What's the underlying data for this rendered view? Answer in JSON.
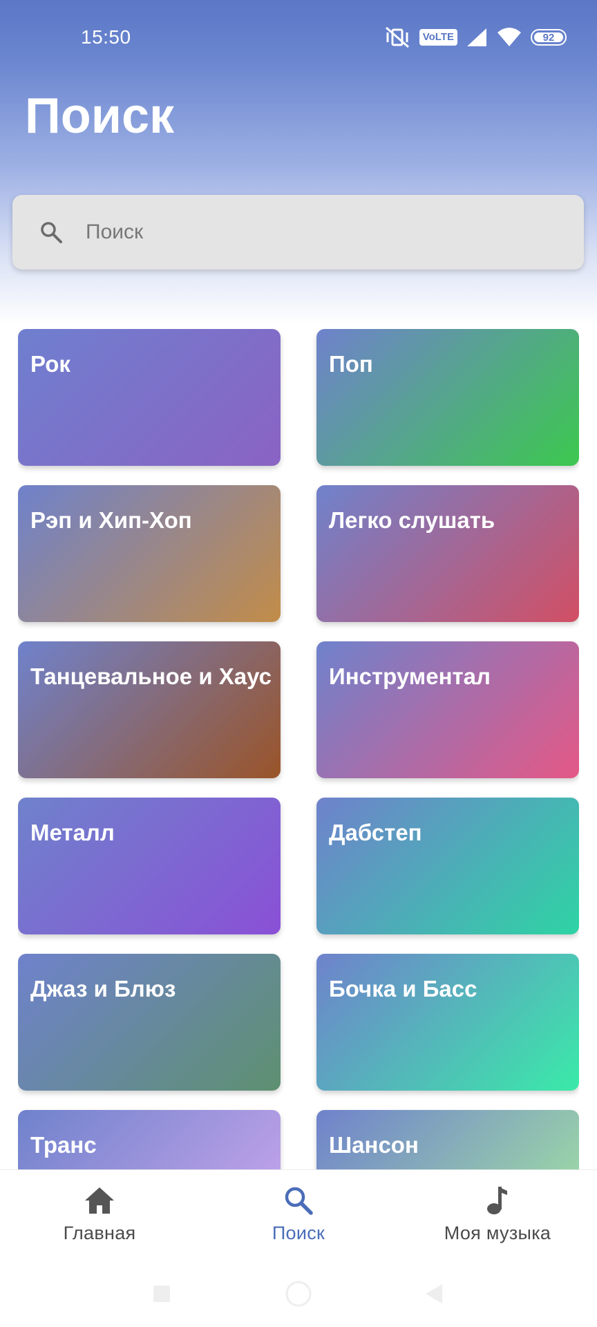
{
  "status_bar": {
    "time": "15:50",
    "network_badge": "VoLTE",
    "battery": "92",
    "icons": [
      "vibrate-off-icon",
      "volte-icon",
      "signal-icon",
      "wifi-icon",
      "battery-icon"
    ]
  },
  "header": {
    "title": "Поиск"
  },
  "search": {
    "placeholder": "Поиск",
    "value": "",
    "icon": "search-icon"
  },
  "genres": [
    {
      "label": "Рок",
      "colors": [
        "#6f7fcf",
        "#8a63c4"
      ]
    },
    {
      "label": "Поп",
      "colors": [
        "#6f82cc",
        "#3cc84e"
      ]
    },
    {
      "label": "Рэп и Хип-Хоп",
      "colors": [
        "#6f82cc",
        "#c28c48"
      ]
    },
    {
      "label": "Легко слушать",
      "colors": [
        "#6f82cc",
        "#d24f64"
      ]
    },
    {
      "label": "Танцевальное и Хаус",
      "colors": [
        "#6f82cc",
        "#9a5428"
      ]
    },
    {
      "label": "Инструментал",
      "colors": [
        "#6f82cc",
        "#e45886"
      ]
    },
    {
      "label": "Металл",
      "colors": [
        "#6f82cc",
        "#8a50d6"
      ]
    },
    {
      "label": "Дабстеп",
      "colors": [
        "#6f82cc",
        "#2ed4a4"
      ]
    },
    {
      "label": "Джаз и Блюз",
      "colors": [
        "#6f82cc",
        "#5e9070"
      ]
    },
    {
      "label": "Бочка и Басс",
      "colors": [
        "#6f82cc",
        "#3aeaa8"
      ]
    },
    {
      "label": "Транс",
      "colors": [
        "#6f82cc",
        "#cea8ee"
      ]
    },
    {
      "label": "Шансон",
      "colors": [
        "#6f82cc",
        "#a4e6a0"
      ]
    }
  ],
  "bottom_nav": {
    "items": [
      {
        "label": "Главная",
        "icon": "home-icon",
        "active": false
      },
      {
        "label": "Поиск",
        "icon": "search-icon",
        "active": true
      },
      {
        "label": "Моя музыка",
        "icon": "music-note-icon",
        "active": false
      }
    ]
  },
  "system_nav": {
    "icons": [
      "recents-square-icon",
      "home-circle-icon",
      "back-triangle-icon"
    ]
  },
  "colors": {
    "header_gradient_top": "#5b77c6",
    "accent": "#4a6db8",
    "search_background": "#e4e4e4",
    "nav_text": "#4a4a4a"
  }
}
